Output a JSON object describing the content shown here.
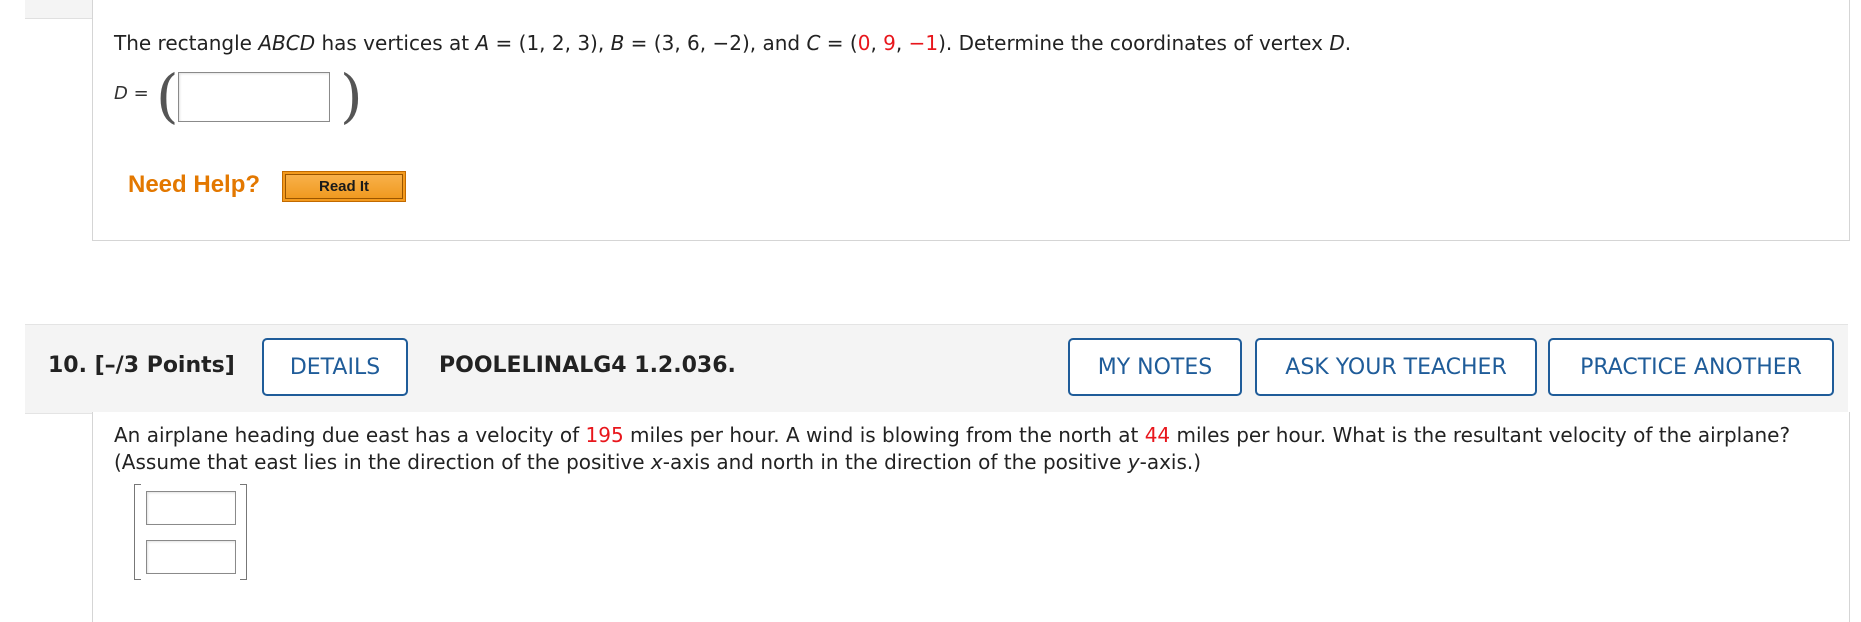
{
  "question9": {
    "text_intro": "The rectangle ",
    "text_abcd": "ABCD",
    "text_has_vertices": " has vertices at ",
    "a_label": "A",
    "a_value": " = (1, 2, 3), ",
    "b_label": "B",
    "b_value": " = (3, 6, −2), and ",
    "c_label": "C",
    "c_eq": " = (",
    "c_x": "0",
    "c_y": "9",
    "c_z": "−1",
    "comma1": ", ",
    "comma2": ", ",
    "close_and_task": "). Determine the coordinates of vertex ",
    "d_var": "D",
    "period": ".",
    "answer_label": "D",
    "answer_eq": " =",
    "answer_value": "",
    "need_help": "Need Help?",
    "read_it": "Read It"
  },
  "question10": {
    "number": "10.  [–/3 Points]",
    "details_label": "DETAILS",
    "code": "POOLELINALG4 1.2.036.",
    "my_notes_label": "MY NOTES",
    "ask_teacher_label": "ASK YOUR TEACHER",
    "practice_another_label": "PRACTICE ANOTHER",
    "line1_a": "An airplane heading due east has a velocity of ",
    "speed": "195",
    "line1_b": " miles per hour. A wind is blowing from the north at ",
    "wind": "44",
    "line1_c": " miles per hour. What is the resultant velocity of the airplane?",
    "line2_a": "(Assume that east lies in the direction of the positive ",
    "x_var": "x",
    "line2_b": "-axis and north in the direction of the positive ",
    "y_var": "y",
    "line2_c": "-axis.)",
    "answer_x": "",
    "answer_y": ""
  },
  "colors": {
    "accent_blue": "#1f5c99",
    "highlight_red": "#e8161c",
    "help_orange": "#e37800"
  }
}
